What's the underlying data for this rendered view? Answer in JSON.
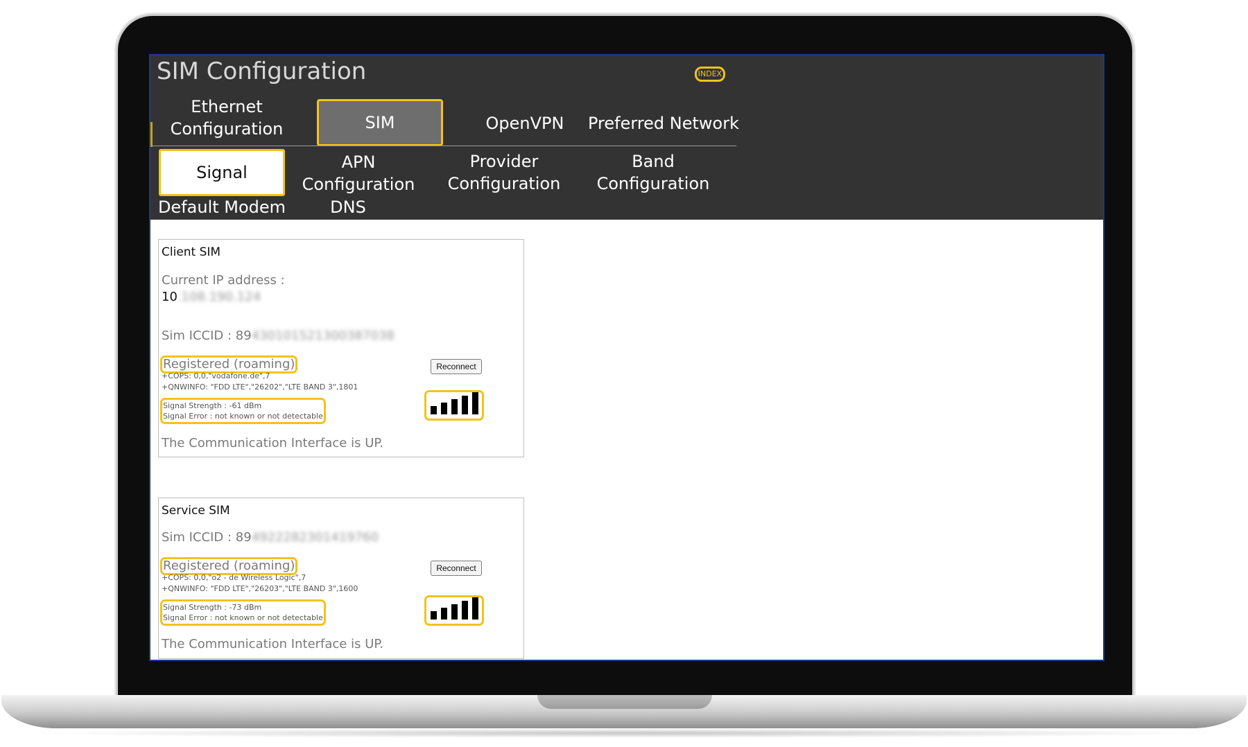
{
  "app": {
    "title": "SIM Configuration",
    "index_label": "INDEX"
  },
  "main_tabs": [
    {
      "label": "Ethernet Configuration"
    },
    {
      "label": "SIM"
    },
    {
      "label": "OpenVPN"
    },
    {
      "label": "Preferred Network"
    }
  ],
  "sub_tabs": [
    {
      "label": "Signal"
    },
    {
      "label": "APN Configuration"
    },
    {
      "label": "Provider Configuration"
    },
    {
      "label": "Band Configuration"
    },
    {
      "label": "Default Modem"
    },
    {
      "label": "DNS"
    }
  ],
  "client_sim": {
    "title": "Client SIM",
    "ip_label": "Current IP address :",
    "ip_prefix": "10",
    "ip_rest": ".108.190.124",
    "iccid_label": "Sim ICCID : 89",
    "iccid_rest": "430101521300387038",
    "status": "Registered (roaming)",
    "cops": "+COPS: 0,0,\"vodafone.de\",7",
    "qnwinfo": "+QNWINFO: \"FDD LTE\",\"26202\",\"LTE BAND 3\",1801",
    "signal_strength": "Signal Strength : -61 dBm",
    "signal_error": "Signal Error : not known or not detectable",
    "reconnect_label": "Reconnect",
    "signal_bars": 5,
    "comm_status": "The Communication Interface is UP."
  },
  "service_sim": {
    "title": "Service SIM",
    "iccid_label": "Sim ICCID : 89",
    "iccid_rest": "4922282301419760",
    "status": "Registered (roaming)",
    "cops": "+COPS: 0,0,\"o2 - de Wireless Logic\",7",
    "qnwinfo": "+QNWINFO: \"FDD LTE\",\"26203\",\"LTE BAND 3\",1600",
    "signal_strength": "Signal Strength : -73 dBm",
    "signal_error": "Signal Error : not known or not detectable",
    "reconnect_label": "Reconnect",
    "signal_bars": 5,
    "comm_status": "The Communication Interface is UP."
  },
  "colors": {
    "accent": "#f0c419",
    "header_bg": "#333333"
  }
}
